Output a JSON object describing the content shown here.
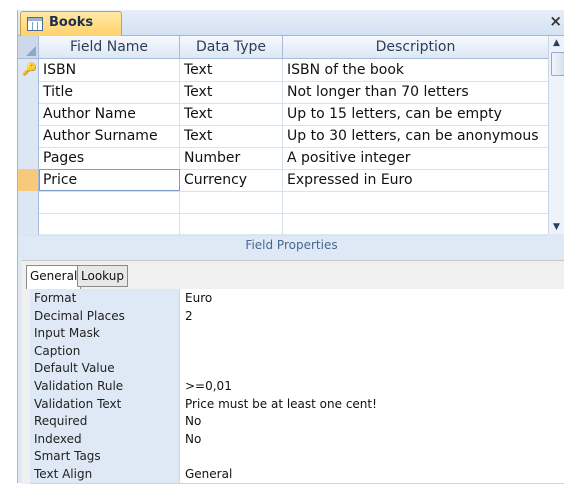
{
  "document": {
    "title": "Books",
    "close_glyph": "×",
    "icon": "table-icon"
  },
  "grid": {
    "headers": [
      "Field Name",
      "Data Type",
      "Description"
    ],
    "rows": [
      {
        "name": "ISBN",
        "type": "Text",
        "description": "ISBN of the book",
        "primary_key": true
      },
      {
        "name": "Title",
        "type": "Text",
        "description": "Not longer than 70 letters"
      },
      {
        "name": "Author Name",
        "type": "Text",
        "description": "Up to 15 letters, can be empty"
      },
      {
        "name": "Author Surname",
        "type": "Text",
        "description": "Up to 30 letters, can be anonymous"
      },
      {
        "name": "Pages",
        "type": "Number",
        "description": "A positive integer"
      },
      {
        "name": "Price",
        "type": "Currency",
        "description": "Expressed in Euro",
        "selected": true
      },
      {
        "name": "",
        "type": "",
        "description": ""
      },
      {
        "name": "",
        "type": "",
        "description": ""
      }
    ]
  },
  "field_properties": {
    "section_label": "Field Properties",
    "tabs": [
      "General",
      "Lookup"
    ],
    "active_tab": "General",
    "properties": [
      {
        "label": "Format",
        "value": "Euro"
      },
      {
        "label": "Decimal Places",
        "value": "2"
      },
      {
        "label": "Input Mask",
        "value": ""
      },
      {
        "label": "Caption",
        "value": ""
      },
      {
        "label": "Default Value",
        "value": ""
      },
      {
        "label": "Validation Rule",
        "value": ">=0,01"
      },
      {
        "label": "Validation Text",
        "value": "Price must be at least one cent!"
      },
      {
        "label": "Required",
        "value": "No"
      },
      {
        "label": "Indexed",
        "value": "No"
      },
      {
        "label": "Smart Tags",
        "value": ""
      },
      {
        "label": "Text Align",
        "value": "General"
      }
    ]
  },
  "colors": {
    "selected_row": "#f8c97a",
    "tab_gold": "#ffd26b",
    "panel_blue": "#dfe9f5"
  }
}
